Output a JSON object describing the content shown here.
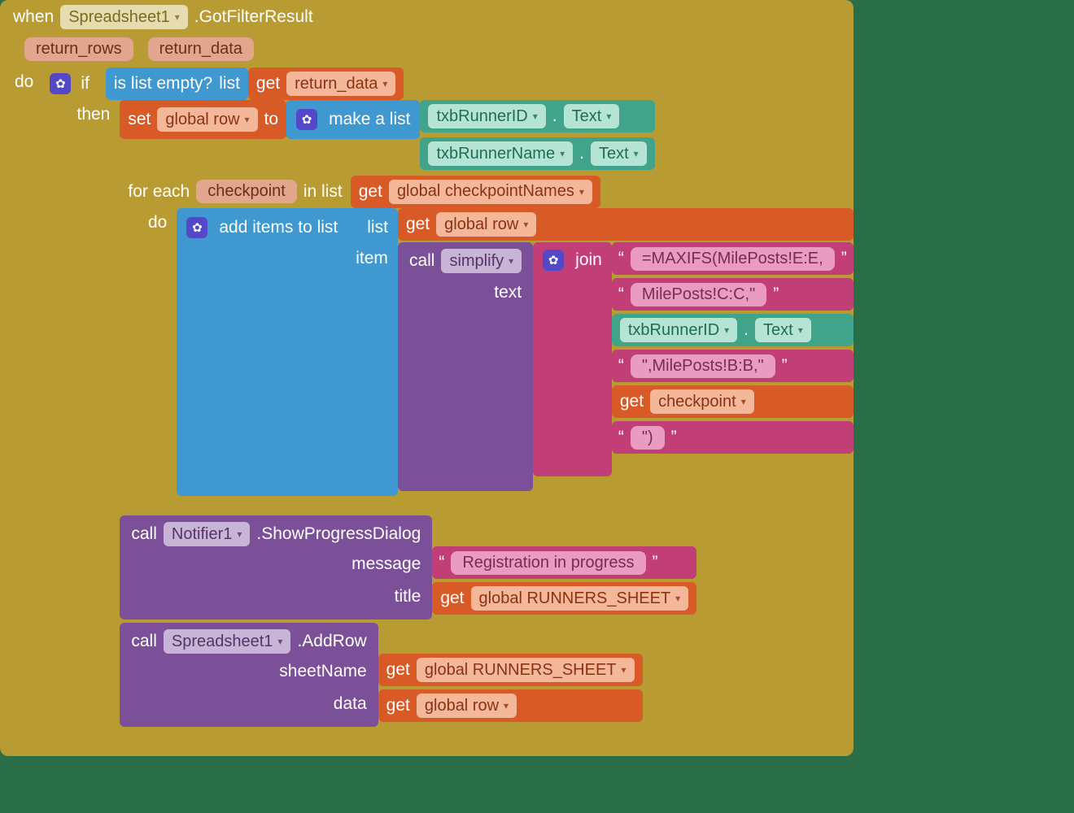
{
  "event": {
    "when": "when",
    "component": "Spreadsheet1",
    "suffix": ".GotFilterResult",
    "params": [
      "return_rows",
      "return_data"
    ],
    "do": "do"
  },
  "ifblock": {
    "if": "if",
    "then": "then",
    "isListEmpty": "is list empty?",
    "listLabel": "list",
    "get": "get",
    "returnDataVar": "return_data"
  },
  "setrow": {
    "set": "set",
    "globalRow": "global row",
    "to": "to",
    "makeAList": "make a list",
    "item1_comp": "txbRunnerID",
    "item1_prop": "Text",
    "item2_comp": "txbRunnerName",
    "item2_prop": "Text",
    "dot": "."
  },
  "foreach": {
    "forEach": "for each",
    "var": "checkpoint",
    "inList": "in list",
    "get": "get",
    "listVar": "global checkpointNames",
    "do": "do"
  },
  "additems": {
    "label": "add items to list",
    "listLabel": "list",
    "itemLabel": "item",
    "get": "get",
    "globalRow": "global row"
  },
  "simplify": {
    "call": "call",
    "proc": "simplify",
    "argText": "text"
  },
  "join": {
    "label": "join",
    "s1": "=MAXIFS(MilePosts!E:E,",
    "s2": "MilePosts!C:C,\"",
    "s3_comp": "txbRunnerID",
    "s3_prop": "Text",
    "dot": ".",
    "s4": "\",MilePosts!B:B,\"",
    "get": "get",
    "s5_var": "checkpoint",
    "s6": "\")",
    "lq": "“",
    "rq": "”"
  },
  "notifier": {
    "call": "call",
    "comp": "Notifier1",
    "method": ".ShowProgressDialog",
    "argMessage": "message",
    "argTitle": "title",
    "msgText": "Registration in progress",
    "get": "get",
    "titleVar": "global RUNNERS_SHEET",
    "lq": "“",
    "rq": "”"
  },
  "addrow": {
    "call": "call",
    "comp": "Spreadsheet1",
    "method": ".AddRow",
    "argSheet": "sheetName",
    "argData": "data",
    "get": "get",
    "sheetVar": "global RUNNERS_SHEET",
    "dataVar": "global row"
  }
}
